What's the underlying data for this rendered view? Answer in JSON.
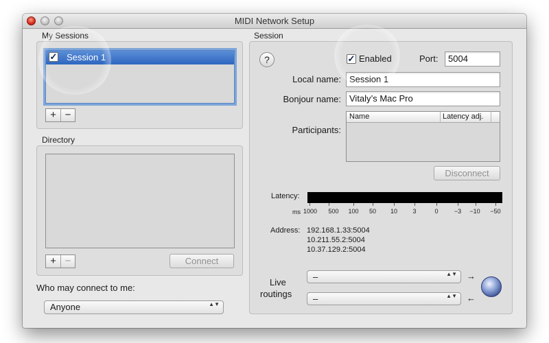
{
  "window": {
    "title": "MIDI Network Setup"
  },
  "colors": {
    "selection": "#2f66c0",
    "meter": "#000000",
    "accent_focus": "#7ea6d9"
  },
  "my_sessions": {
    "label": "My Sessions",
    "items": [
      {
        "label": "Session 1",
        "checked": true
      }
    ],
    "add_label": "+",
    "remove_label": "−"
  },
  "directory": {
    "label": "Directory",
    "add_label": "+",
    "remove_label": "−",
    "connect_label": "Connect"
  },
  "who_connect": {
    "label": "Who may connect to me:",
    "value": "Anyone"
  },
  "session": {
    "label": "Session",
    "help_label": "?",
    "enabled_label": "Enabled",
    "enabled": true,
    "port_label": "Port:",
    "port_value": "5004",
    "local_name_label": "Local name:",
    "local_name_value": "Session 1",
    "bonjour_name_label": "Bonjour name:",
    "bonjour_name_value": "Vitaly’s Mac Pro",
    "participants_label": "Participants:",
    "participants_columns": [
      "Name",
      "Latency adj."
    ],
    "disconnect_label": "Disconnect",
    "latency_label": "Latency:",
    "latency_unit": "ms",
    "latency_scale": [
      "1000",
      "500",
      "100",
      "50",
      "10",
      "3",
      "0",
      "−3",
      "−10",
      "−50"
    ],
    "address_label": "Address:",
    "addresses": [
      "192.168.1.33:5004",
      "10.211.55.2:5004",
      "10.37.129.2:5004"
    ],
    "live_routings_label_1": "Live",
    "live_routings_label_2": "routings",
    "routing_in_value": "–",
    "routing_out_value": "–",
    "arrow_in": "→",
    "arrow_out": "←",
    "popup_arrows": "▲▼"
  }
}
